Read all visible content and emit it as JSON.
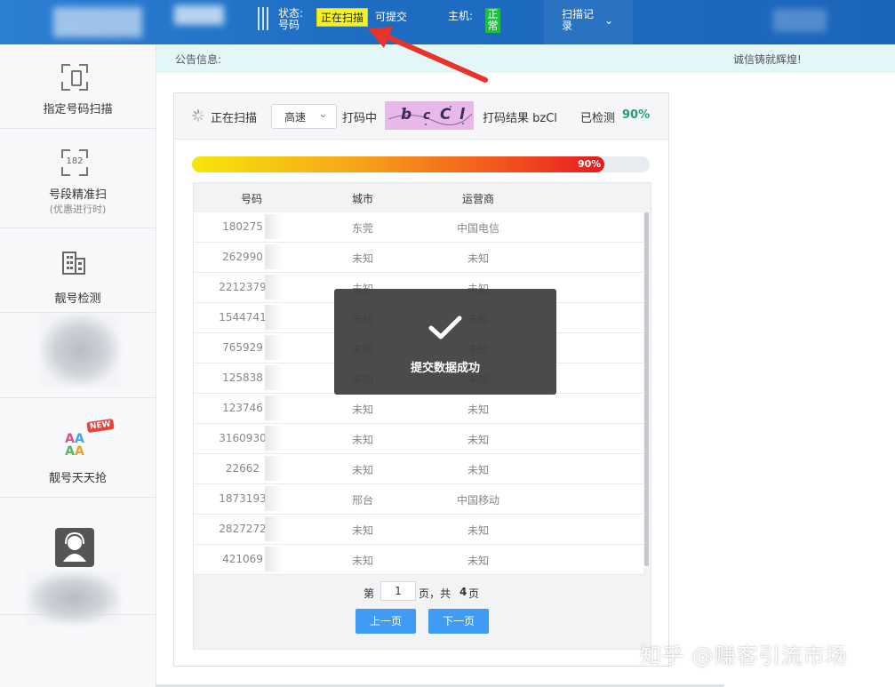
{
  "topbar": {
    "status_label": "状态:号码",
    "status_badge": "正在扫描",
    "submit_text": "可提交",
    "host_label": "主机:",
    "host_badge": "正常",
    "record_label": "扫描记录",
    "record_icon": "chevron-down-icon",
    "colors": {
      "bar": "#1e6dc2",
      "status_badge": "#f4f12a",
      "host_badge": "#1fbd45"
    }
  },
  "notice": {
    "left_text": "公告信息:",
    "right_text": "诚信铸就辉煌!"
  },
  "sidebar": {
    "items": [
      {
        "label": "指定号码扫描",
        "icon": "phone-scan-icon"
      },
      {
        "label": "号段精准扫",
        "sub": "(优惠进行时)",
        "icon": "number-scan-icon",
        "icon_text": "182"
      },
      {
        "label": "靓号检测",
        "icon": "building-icon"
      },
      {
        "label": "",
        "icon": "blurred-icon"
      },
      {
        "label": "靓号天天抢",
        "icon": "aa-icon",
        "badge": "NEW"
      },
      {
        "label": "",
        "icon": "customer-service-icon"
      }
    ]
  },
  "toolbar": {
    "scanning_label": "正在扫描",
    "speed_value": "高速",
    "coding_label": "打码中",
    "captcha_chars": [
      "b",
      "c",
      "C",
      "l"
    ],
    "result_label": "打码结果 bzCl",
    "checked_label": "已检测",
    "checked_pct": "90%"
  },
  "progress": {
    "value": 0.9,
    "label": "90%"
  },
  "table": {
    "headers": [
      "号码",
      "城市",
      "运营商"
    ],
    "rows": [
      [
        "180275",
        "东莞",
        "中国电信"
      ],
      [
        "262990",
        "未知",
        "未知"
      ],
      [
        "2212379",
        "未知",
        "未知"
      ],
      [
        "1544741",
        "未知",
        "未知"
      ],
      [
        "765929",
        "未知",
        "未知"
      ],
      [
        "125838",
        "未知",
        "未知"
      ],
      [
        "123746",
        "未知",
        "未知"
      ],
      [
        "3160930",
        "未知",
        "未知"
      ],
      [
        "22662",
        "未知",
        "未知"
      ],
      [
        "1873193",
        "邢台",
        "中国移动"
      ],
      [
        "2827272",
        "未知",
        "未知"
      ],
      [
        "421069",
        "未知",
        "未知"
      ]
    ]
  },
  "pager": {
    "prefix": "第",
    "current": "1",
    "middle": "页，共",
    "total": "4",
    "suffix": "页",
    "prev_label": "上一页",
    "next_label": "下一页"
  },
  "toast": {
    "message": "提交数据成功",
    "icon": "checkmark-icon"
  },
  "watermark": "知乎 @赚客引流市场"
}
